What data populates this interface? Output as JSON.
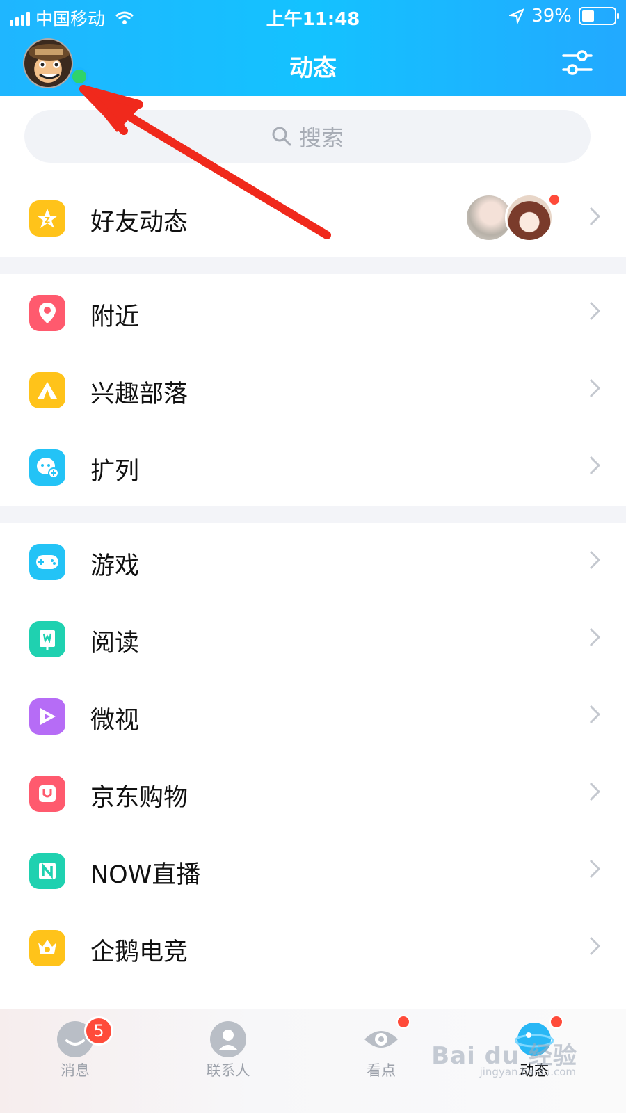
{
  "status_bar": {
    "carrier": "中国移动",
    "time": "上午11:48",
    "battery": "39%",
    "battery_level": 0.39
  },
  "header": {
    "title": "动态"
  },
  "search": {
    "placeholder": "搜索"
  },
  "sections": [
    {
      "items": [
        {
          "label": "好友动态",
          "icon": "star-q-icon",
          "color": "#ffc31a"
        }
      ]
    },
    {
      "items": [
        {
          "label": "附近",
          "icon": "location-pin-icon",
          "color": "#ff5a6e"
        },
        {
          "label": "兴趣部落",
          "icon": "tent-icon",
          "color": "#ffc31a"
        },
        {
          "label": "扩列",
          "icon": "chat-plus-icon",
          "color": "#23c3f6"
        }
      ]
    },
    {
      "items": [
        {
          "label": "游戏",
          "icon": "gamepad-icon",
          "color": "#23c3f6"
        },
        {
          "label": "阅读",
          "icon": "book-icon",
          "color": "#1fd1b0"
        },
        {
          "label": "微视",
          "icon": "play-icon",
          "color": "#b66cf6"
        },
        {
          "label": "京东购物",
          "icon": "shopping-bag-icon",
          "color": "#ff5a6e"
        },
        {
          "label": "NOW直播",
          "icon": "now-live-icon",
          "color": "#1fd1b0"
        },
        {
          "label": "企鹅电竞",
          "icon": "esports-crown-icon",
          "color": "#ffc31a"
        }
      ]
    }
  ],
  "tabbar": {
    "tabs": [
      {
        "label": "消息",
        "badge": "5"
      },
      {
        "label": "联系人"
      },
      {
        "label": "看点"
      },
      {
        "label": "动态"
      }
    ]
  },
  "watermark": {
    "text": "Bai du 经验",
    "sub": "jingyan.baidu.com"
  },
  "colors": {
    "header_blue": "#1fb6ff",
    "badge_red": "#ff4b3a",
    "online_green": "#2fd36b",
    "annotation_red": "#f0291c"
  }
}
